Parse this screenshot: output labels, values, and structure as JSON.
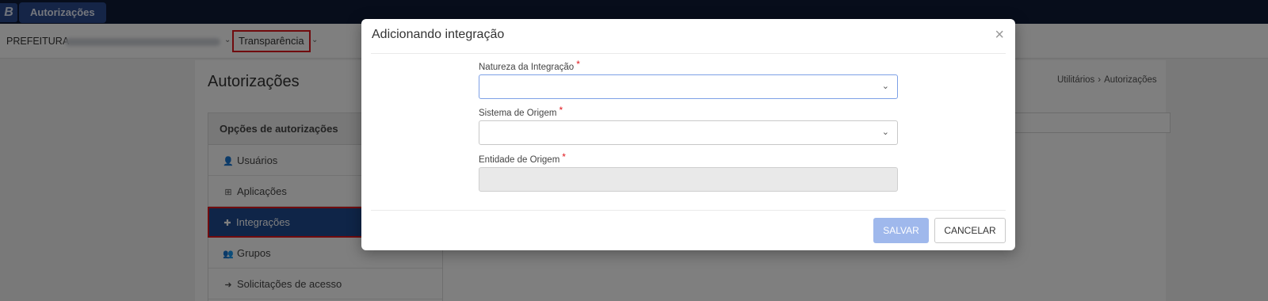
{
  "topbar": {
    "logo": "B",
    "app_name": "Autorizações"
  },
  "subnav": {
    "prefix": "PREFEITURA",
    "menu_transparencia": "Transparência",
    "chevron": "⌄"
  },
  "page": {
    "title": "Autorizações",
    "breadcrumb": [
      "Utilitários",
      "Autorizações"
    ],
    "breadcrumb_sep": "›"
  },
  "sidebar": {
    "heading": "Opções de autorizações",
    "items": [
      {
        "label": "Usuários",
        "icon": "user-icon",
        "glyph": "👤"
      },
      {
        "label": "Aplicações",
        "icon": "sitemap-icon",
        "glyph": "⊞"
      },
      {
        "label": "Integrações",
        "icon": "puzzle-icon",
        "glyph": "✚"
      },
      {
        "label": "Grupos",
        "icon": "users-icon",
        "glyph": "👥"
      },
      {
        "label": "Solicitações de acesso",
        "icon": "sign-in-icon",
        "glyph": "➜"
      }
    ],
    "active_index": 2
  },
  "modal": {
    "title": "Adicionando integração",
    "close_glyph": "×",
    "fields": [
      {
        "label": "Natureza da Integração",
        "required_mark": "*",
        "value": ""
      },
      {
        "label": "Sistema de Origem",
        "required_mark": "*",
        "value": ""
      },
      {
        "label": "Entidade de Origem",
        "required_mark": "*",
        "value": ""
      }
    ],
    "caret_glyph": "⌄",
    "save_label": "SALVAR",
    "cancel_label": "CANCELAR"
  },
  "colors": {
    "topbar": "#0f1a36",
    "brand": "#2b4a8f",
    "active_item": "#1f4b91",
    "highlight_border": "#e0161c",
    "save_button": "#9fb8ec"
  }
}
